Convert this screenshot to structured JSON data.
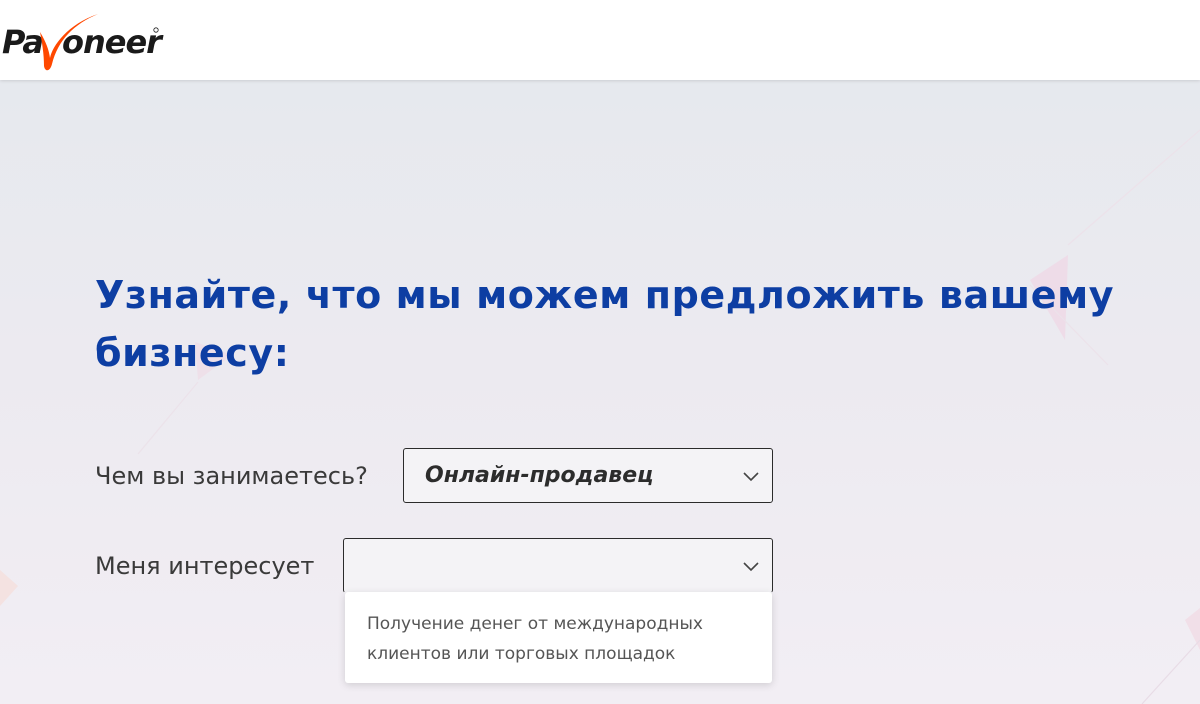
{
  "header": {
    "logo_text": "Payoneer",
    "brand_color": "#ff4800",
    "logo_icon": "payoneer-logo"
  },
  "hero": {
    "title": "Узнайте, что мы можем предложить вашему бизнесу:",
    "title_color": "#0d3ea3"
  },
  "form": {
    "occupation": {
      "label": "Чем вы занимаетесь?",
      "value": "Онлайн-продавец",
      "icon": "chevron-down-icon"
    },
    "interest": {
      "label": "Меня интересует",
      "value": "",
      "icon": "chevron-down-icon",
      "options": [
        "Получение денег от международных клиентов или торговых площадок"
      ]
    }
  }
}
